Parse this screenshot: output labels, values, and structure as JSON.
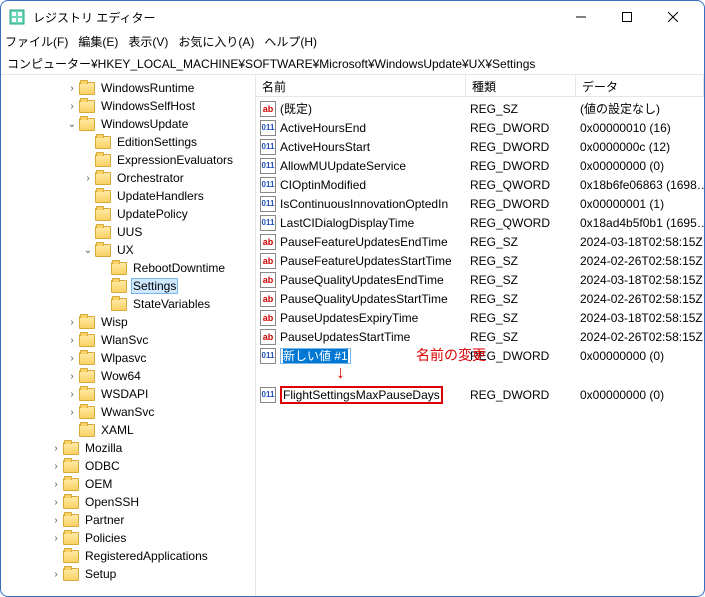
{
  "window": {
    "title": "レジストリ エディター"
  },
  "menu": {
    "file": "ファイル(F)",
    "edit": "編集(E)",
    "view": "表示(V)",
    "fav": "お気に入り(A)",
    "help": "ヘルプ(H)"
  },
  "address": "コンピューター¥HKEY_LOCAL_MACHINE¥SOFTWARE¥Microsoft¥WindowsUpdate¥UX¥Settings",
  "columns": {
    "name": "名前",
    "type": "種類",
    "data": "データ"
  },
  "tree": [
    {
      "indent": 4,
      "tw": ">",
      "label": "WindowsRuntime"
    },
    {
      "indent": 4,
      "tw": ">",
      "label": "WindowsSelfHost"
    },
    {
      "indent": 4,
      "tw": "v",
      "label": "WindowsUpdate"
    },
    {
      "indent": 5,
      "tw": "",
      "label": "EditionSettings"
    },
    {
      "indent": 5,
      "tw": "",
      "label": "ExpressionEvaluators"
    },
    {
      "indent": 5,
      "tw": ">",
      "label": "Orchestrator"
    },
    {
      "indent": 5,
      "tw": "",
      "label": "UpdateHandlers"
    },
    {
      "indent": 5,
      "tw": "",
      "label": "UpdatePolicy"
    },
    {
      "indent": 5,
      "tw": "",
      "label": "UUS"
    },
    {
      "indent": 5,
      "tw": "v",
      "label": "UX"
    },
    {
      "indent": 6,
      "tw": "",
      "label": "RebootDowntime"
    },
    {
      "indent": 6,
      "tw": "",
      "label": "Settings",
      "selected": true
    },
    {
      "indent": 6,
      "tw": "",
      "label": "StateVariables"
    },
    {
      "indent": 4,
      "tw": ">",
      "label": "Wisp"
    },
    {
      "indent": 4,
      "tw": ">",
      "label": "WlanSvc"
    },
    {
      "indent": 4,
      "tw": ">",
      "label": "Wlpasvc"
    },
    {
      "indent": 4,
      "tw": ">",
      "label": "Wow64"
    },
    {
      "indent": 4,
      "tw": ">",
      "label": "WSDAPI"
    },
    {
      "indent": 4,
      "tw": ">",
      "label": "WwanSvc"
    },
    {
      "indent": 4,
      "tw": "",
      "label": "XAML"
    },
    {
      "indent": 3,
      "tw": ">",
      "label": "Mozilla"
    },
    {
      "indent": 3,
      "tw": ">",
      "label": "ODBC"
    },
    {
      "indent": 3,
      "tw": ">",
      "label": "OEM"
    },
    {
      "indent": 3,
      "tw": ">",
      "label": "OpenSSH"
    },
    {
      "indent": 3,
      "tw": ">",
      "label": "Partner"
    },
    {
      "indent": 3,
      "tw": ">",
      "label": "Policies"
    },
    {
      "indent": 3,
      "tw": "",
      "label": "RegisteredApplications"
    },
    {
      "indent": 3,
      "tw": ">",
      "label": "Setup"
    }
  ],
  "values": [
    {
      "icon": "ab",
      "name": "(既定)",
      "type": "REG_SZ",
      "data": "(値の設定なし)"
    },
    {
      "icon": "bin",
      "name": "ActiveHoursEnd",
      "type": "REG_DWORD",
      "data": "0x00000010 (16)"
    },
    {
      "icon": "bin",
      "name": "ActiveHoursStart",
      "type": "REG_DWORD",
      "data": "0x0000000c (12)"
    },
    {
      "icon": "bin",
      "name": "AllowMUUpdateService",
      "type": "REG_DWORD",
      "data": "0x00000000 (0)"
    },
    {
      "icon": "bin",
      "name": "CIOptinModified",
      "type": "REG_QWORD",
      "data": "0x18b6fe06863 (1698…"
    },
    {
      "icon": "bin",
      "name": "IsContinuousInnovationOptedIn",
      "type": "REG_DWORD",
      "data": "0x00000001 (1)"
    },
    {
      "icon": "bin",
      "name": "LastCIDialogDisplayTime",
      "type": "REG_QWORD",
      "data": "0x18ad4b5f0b1 (1695…"
    },
    {
      "icon": "ab",
      "name": "PauseFeatureUpdatesEndTime",
      "type": "REG_SZ",
      "data": "2024-03-18T02:58:15Z"
    },
    {
      "icon": "ab",
      "name": "PauseFeatureUpdatesStartTime",
      "type": "REG_SZ",
      "data": "2024-02-26T02:58:15Z"
    },
    {
      "icon": "ab",
      "name": "PauseQualityUpdatesEndTime",
      "type": "REG_SZ",
      "data": "2024-03-18T02:58:15Z"
    },
    {
      "icon": "ab",
      "name": "PauseQualityUpdatesStartTime",
      "type": "REG_SZ",
      "data": "2024-02-26T02:58:15Z"
    },
    {
      "icon": "ab",
      "name": "PauseUpdatesExpiryTime",
      "type": "REG_SZ",
      "data": "2024-03-18T02:58:15Z"
    },
    {
      "icon": "ab",
      "name": "PauseUpdatesStartTime",
      "type": "REG_SZ",
      "data": "2024-02-26T02:58:15Z"
    }
  ],
  "editing": {
    "icon": "bin",
    "name": "新しい値 #1",
    "type": "REG_DWORD",
    "data": "0x00000000 (0)"
  },
  "target": {
    "icon": "bin",
    "name": "FlightSettingsMaxPauseDays",
    "type": "REG_DWORD",
    "data": "0x00000000 (0)"
  },
  "annotation": {
    "rename": "名前の変更",
    "arrow": "↓"
  }
}
